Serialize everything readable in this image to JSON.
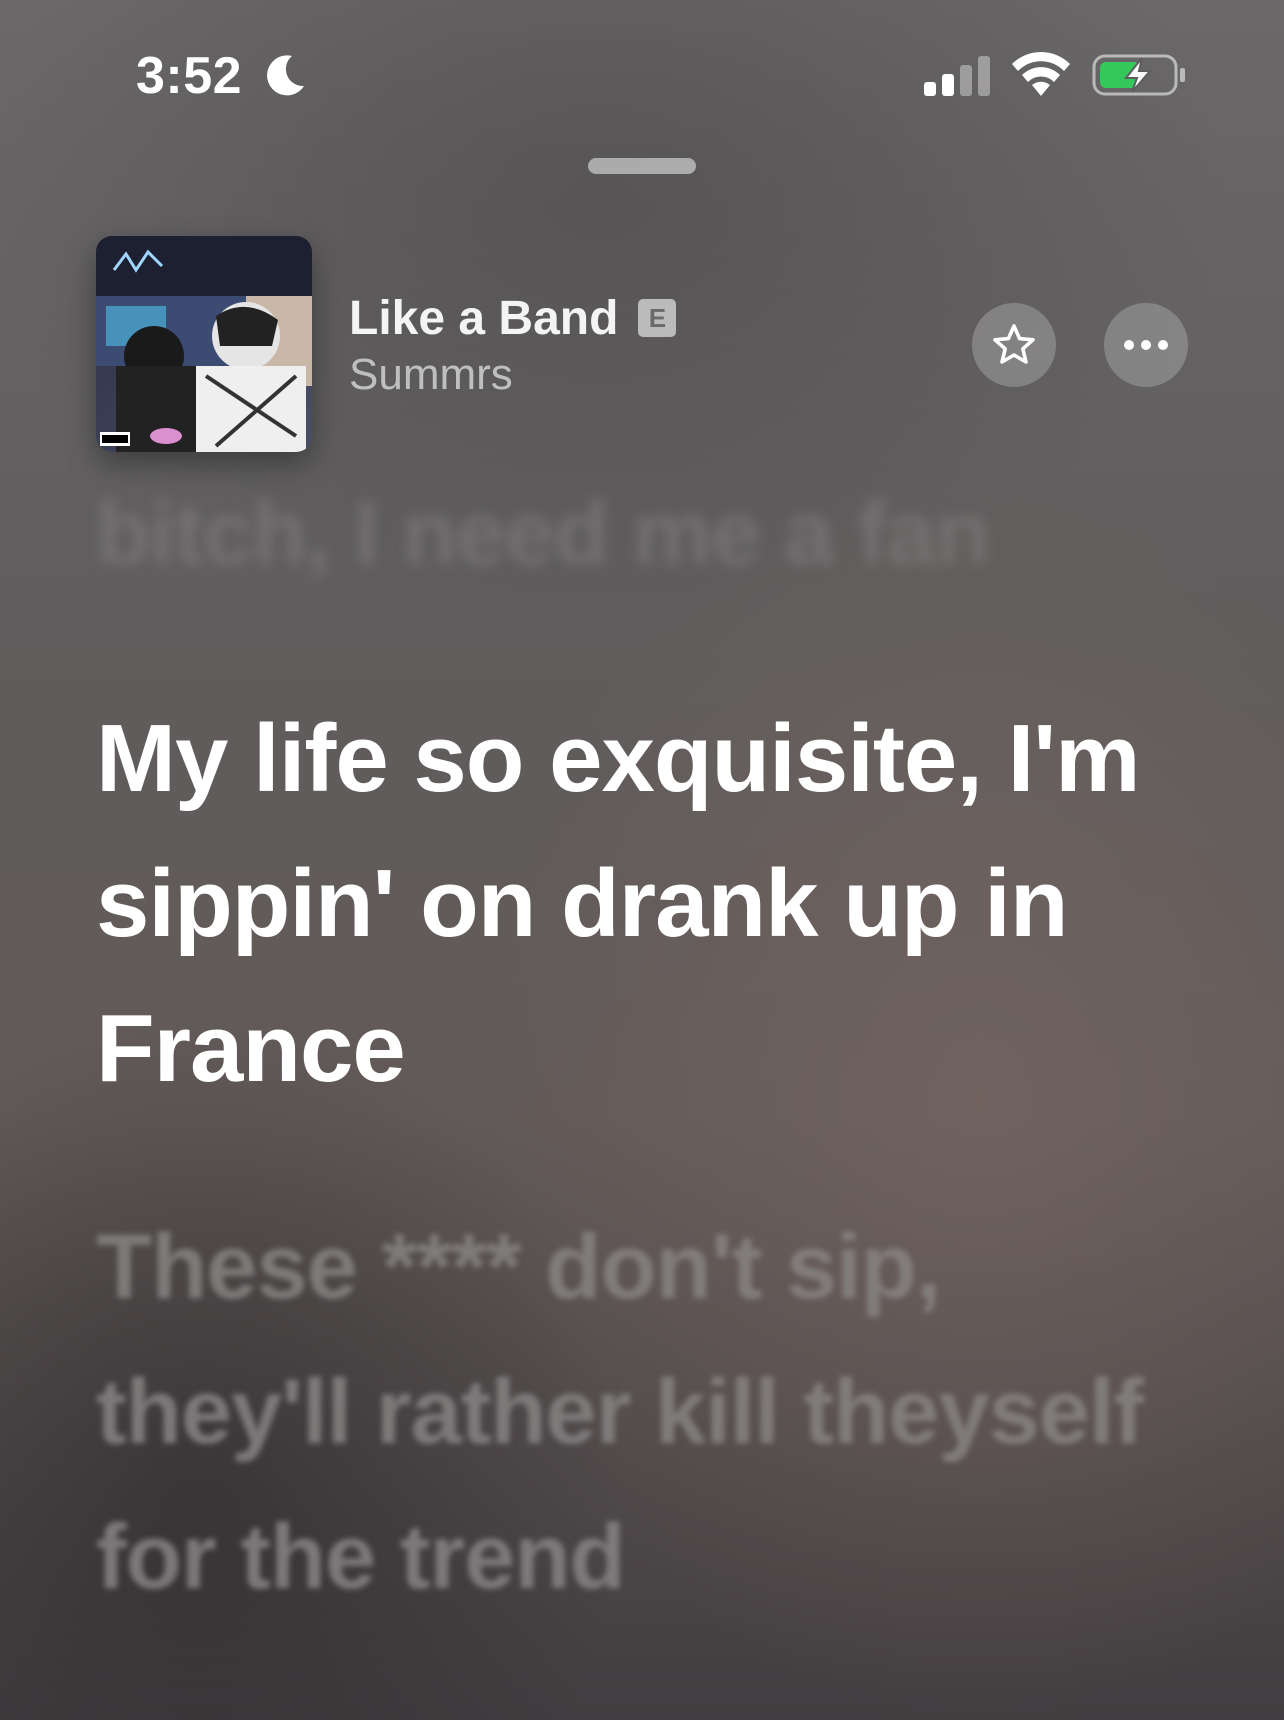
{
  "status_bar": {
    "time": "3:52",
    "focus_icon": "moon-icon",
    "signal_icon": "cellular-signal-icon",
    "wifi_icon": "wifi-icon",
    "battery_icon": "battery-charging-icon",
    "battery_color": "#34c759"
  },
  "now_playing": {
    "title": "Like a Band",
    "explicit_badge": "E",
    "artist": "Summrs",
    "favorite_icon": "star-icon",
    "more_icon": "ellipsis-icon"
  },
  "lyrics": {
    "previous": "bitch, I need me a fan",
    "current": "My life so exquisite, I'm sippin' on drank up in France",
    "next": "These **** don't sip, they'll rather kill theyself for the trend"
  }
}
